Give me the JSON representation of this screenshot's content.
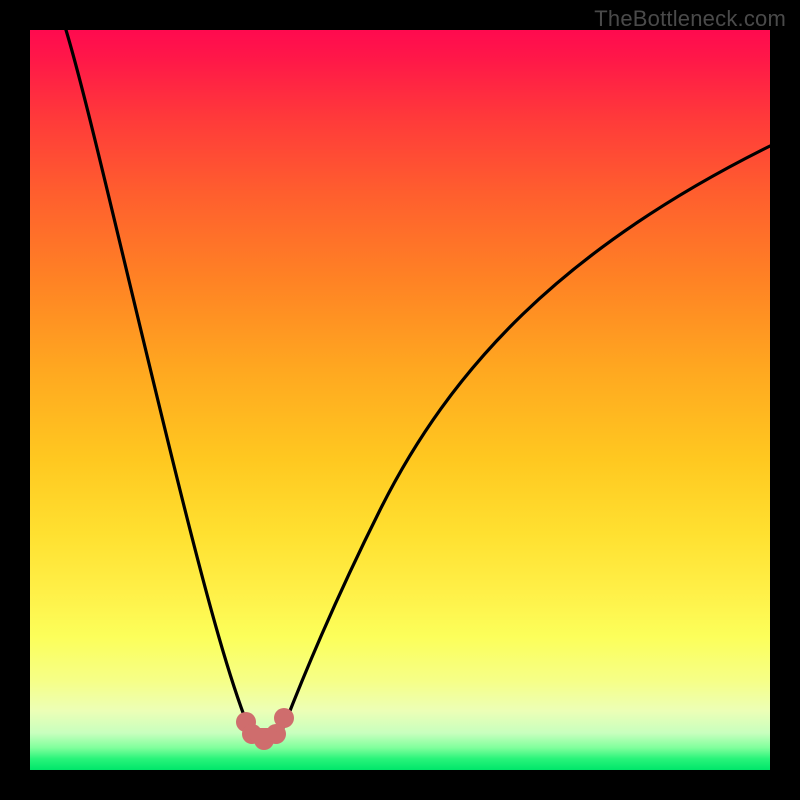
{
  "watermark": {
    "text": "TheBottleneck.com"
  },
  "chart_data": {
    "type": "line",
    "title": "",
    "xlabel": "",
    "ylabel": "",
    "xlim": [
      0,
      100
    ],
    "ylim": [
      0,
      100
    ],
    "grid": false,
    "legend": false,
    "series": [
      {
        "name": "bottleneck-curve",
        "color": "#000000",
        "x": [
          0,
          4,
          8,
          12,
          16,
          20,
          22,
          24,
          26,
          28,
          30,
          31,
          32,
          33,
          34,
          36,
          38,
          42,
          48,
          56,
          64,
          72,
          80,
          88,
          96,
          100
        ],
        "y": [
          100,
          90,
          78,
          65,
          52,
          38,
          31,
          24,
          18,
          12,
          7,
          5,
          4,
          4,
          5,
          8,
          12,
          20,
          32,
          46,
          57,
          66,
          73,
          78,
          82,
          84
        ]
      },
      {
        "name": "optimal-region-markers",
        "color": "#cf6d6d",
        "type": "scatter",
        "x": [
          29.4,
          30.5,
          31.8,
          33.0,
          34.2
        ],
        "y": [
          6.0,
          4.8,
          4.2,
          4.8,
          6.4
        ]
      }
    ],
    "background_gradient": {
      "top": "#ff0a4f",
      "upper_mid": "#ffa820",
      "mid": "#fff048",
      "lower": "#28f47a",
      "bottom": "#00e66a"
    }
  }
}
